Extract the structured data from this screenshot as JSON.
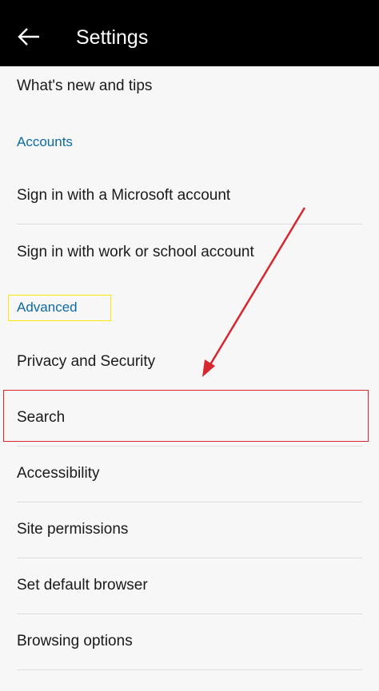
{
  "app_bar": {
    "title": "Settings",
    "back_icon": "arrow-left-icon"
  },
  "rows_top": [
    {
      "label": "What's new and tips"
    }
  ],
  "sections": [
    {
      "header": "Accounts",
      "items": [
        {
          "label": "Sign in with a Microsoft account"
        },
        {
          "label": "Sign in with work or school account"
        }
      ]
    },
    {
      "header": "Advanced",
      "items": [
        {
          "label": "Privacy and Security"
        },
        {
          "label": "Search"
        },
        {
          "label": "Accessibility"
        },
        {
          "label": "Site permissions"
        },
        {
          "label": "Set default browser"
        },
        {
          "label": "Browsing options"
        }
      ]
    }
  ],
  "colors": {
    "app_bar_bg": "#000000",
    "section_header": "#0b6aa6",
    "annotation_yellow": "#ffe500",
    "annotation_red": "#d7262e",
    "background": "#f7f7f7"
  }
}
